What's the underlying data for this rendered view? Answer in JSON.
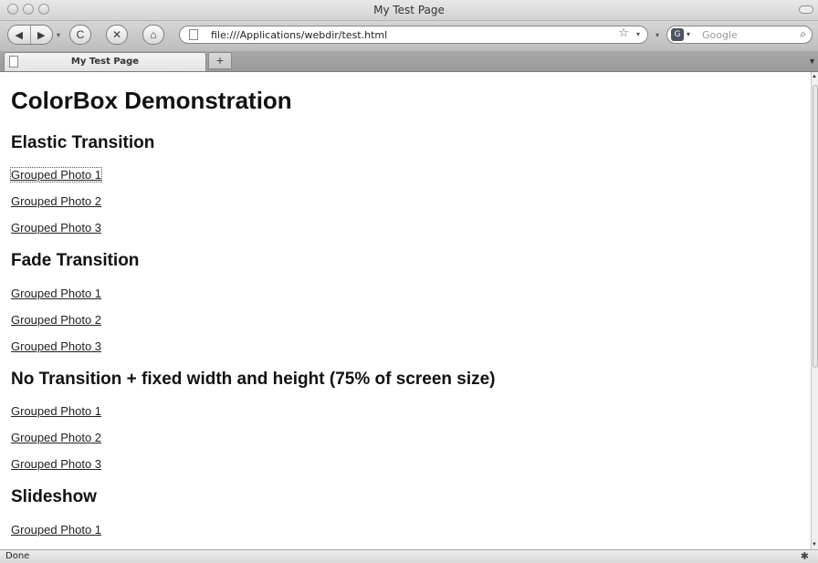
{
  "window": {
    "title": "My Test Page"
  },
  "toolbar": {
    "back_icon": "◀",
    "forward_icon": "▶",
    "history_arrow": "▾",
    "reload_icon": "C",
    "stop_icon": "✕",
    "home_icon": "⌂",
    "url": "file:///Applications/webdir/test.html",
    "bookmark_star": "☆",
    "url_dropdown": "▾",
    "search_engine_label": "G",
    "search_engine_arrow": "▾",
    "search_placeholder": "Google",
    "search_icon": "⌕"
  },
  "tabs": {
    "active_label": "My Test Page",
    "new_tab_label": "+",
    "tab_menu_arrow": "▼"
  },
  "page": {
    "heading": "ColorBox Demonstration",
    "sections": [
      {
        "title": "Elastic Transition",
        "links": [
          "Grouped Photo 1",
          "Grouped Photo 2",
          "Grouped Photo 3"
        ]
      },
      {
        "title": "Fade Transition",
        "links": [
          "Grouped Photo 1",
          "Grouped Photo 2",
          "Grouped Photo 3"
        ]
      },
      {
        "title": "No Transition + fixed width and height (75% of screen size)",
        "links": [
          "Grouped Photo 1",
          "Grouped Photo 2",
          "Grouped Photo 3"
        ]
      },
      {
        "title": "Slideshow",
        "links": [
          "Grouped Photo 1"
        ]
      }
    ]
  },
  "statusbar": {
    "text": "Done",
    "addon_icon": "✱"
  }
}
